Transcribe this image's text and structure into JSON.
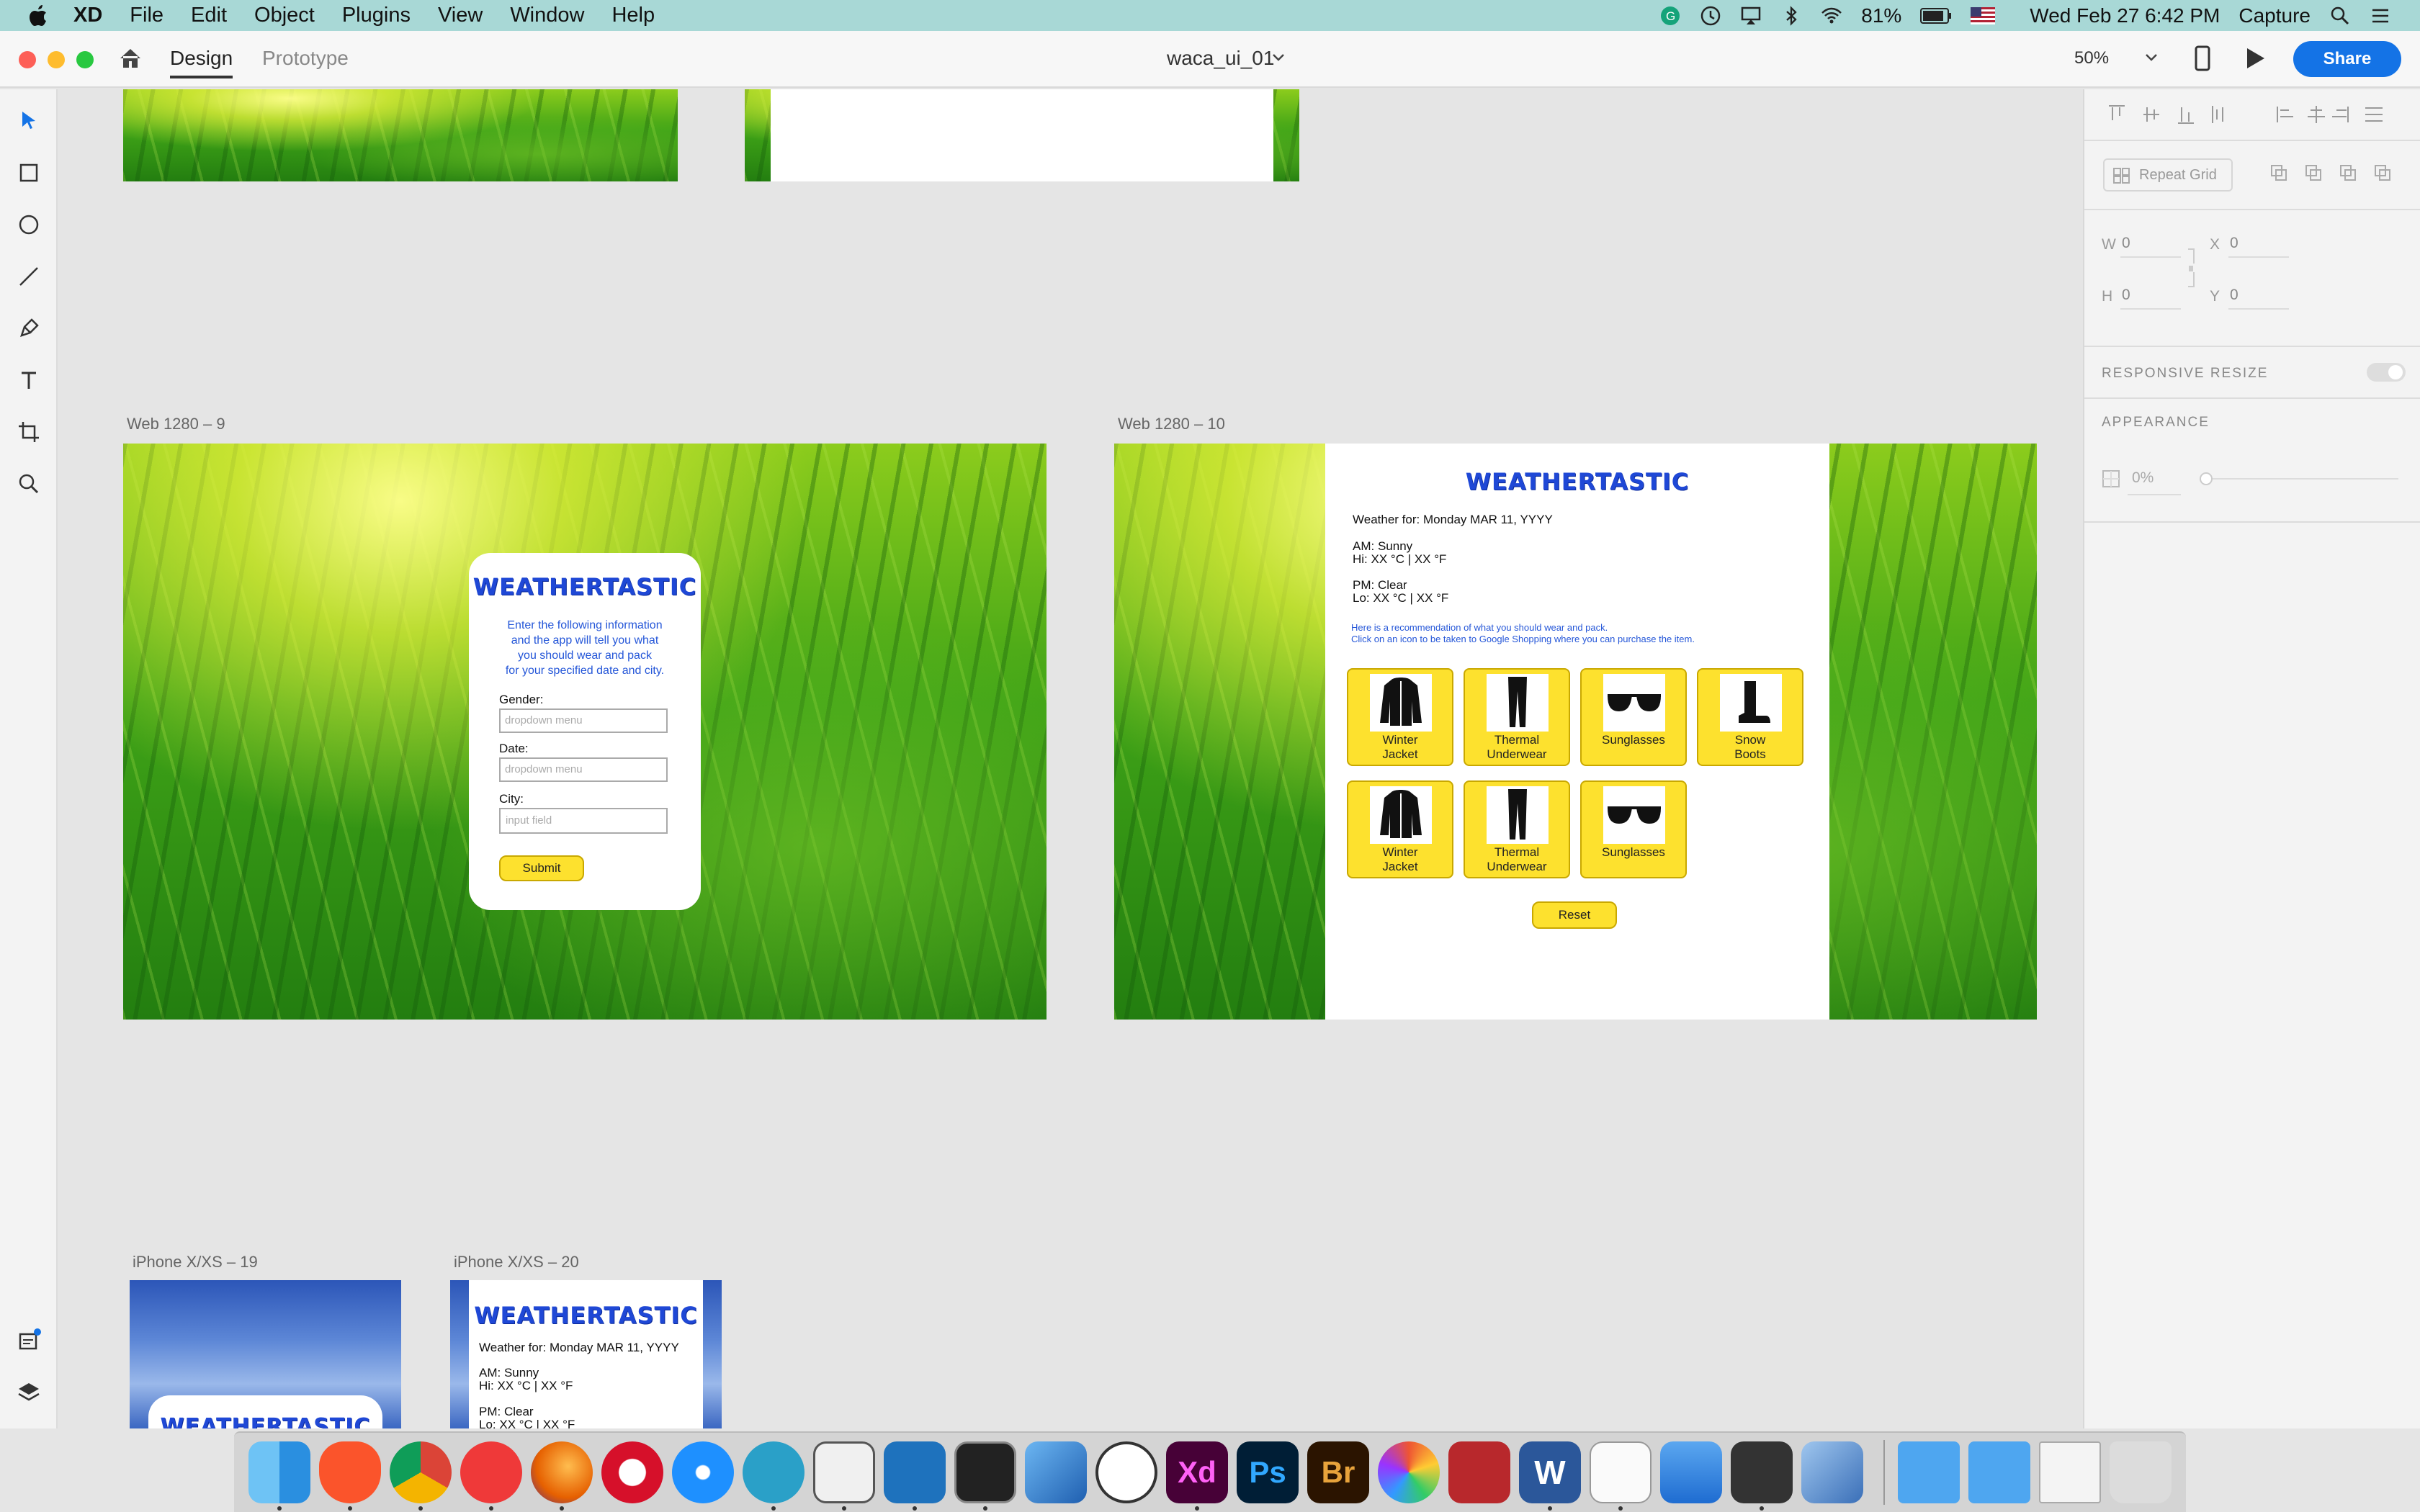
{
  "menubar": {
    "app": "XD",
    "items": [
      "File",
      "Edit",
      "Object",
      "Plugins",
      "View",
      "Window",
      "Help"
    ],
    "battery": "81%",
    "datetime": "Wed Feb 27  6:42 PM",
    "capture": "Capture"
  },
  "titlebar": {
    "tab_design": "Design",
    "tab_prototype": "Prototype",
    "document": "waca_ui_01",
    "zoom": "50%",
    "share": "Share"
  },
  "right_panel": {
    "repeat_grid": "Repeat Grid",
    "w_label": "W",
    "w_value": "0",
    "h_label": "H",
    "h_value": "0",
    "x_label": "X",
    "x_value": "0",
    "y_label": "Y",
    "y_value": "0",
    "responsive_resize": "RESPONSIVE RESIZE",
    "appearance": "APPEARANCE",
    "opacity": "0%"
  },
  "artboards": {
    "web9": {
      "label": "Web 1280 – 9",
      "logo": "WEATHERTASTIC",
      "intro": [
        "Enter the following information",
        "and the app will tell you what",
        "you should wear and pack",
        "for your specified date and city."
      ],
      "gender_label": "Gender:",
      "gender_placeholder": "dropdown menu",
      "date_label": "Date:",
      "date_placeholder": "dropdown menu",
      "city_label": "City:",
      "city_placeholder": "input field",
      "submit": "Submit"
    },
    "web10": {
      "label": "Web 1280 – 10",
      "logo": "WEATHERTASTIC",
      "weather_for": "Weather for: Monday MAR 11, YYYY",
      "am": "AM: Sunny",
      "hi": "Hi: XX °C | XX °F",
      "pm": "PM: Clear",
      "lo": "Lo: XX °C | XX °F",
      "rec1": "Here is a recommendation of what you should wear and pack.",
      "rec2": "Click on an icon to be taken to Google Shopping where you can purchase the item.",
      "items_row1": [
        {
          "l1": "Winter",
          "l2": "Jacket",
          "icon": "jacket-icon"
        },
        {
          "l1": "Thermal",
          "l2": "Underwear",
          "icon": "thermal-underwear-icon"
        },
        {
          "l1": "Sunglasses",
          "l2": "",
          "icon": "sunglasses-icon"
        },
        {
          "l1": "Snow",
          "l2": "Boots",
          "icon": "boot-icon"
        }
      ],
      "items_row2": [
        {
          "l1": "Winter",
          "l2": "Jacket",
          "icon": "jacket-icon"
        },
        {
          "l1": "Thermal",
          "l2": "Underwear",
          "icon": "thermal-underwear-icon"
        },
        {
          "l1": "Sunglasses",
          "l2": "",
          "icon": "sunglasses-icon"
        }
      ],
      "reset": "Reset"
    },
    "iphone19": {
      "label": "iPhone X/XS – 19",
      "logo": "WEATHERTASTIC"
    },
    "iphone20": {
      "label": "iPhone X/XS – 20",
      "logo": "WEATHERTASTIC",
      "weather_for": "Weather for: Monday MAR 11, YYYY",
      "am": "AM: Sunny",
      "hi": "Hi: XX °C | XX °F",
      "pm": "PM: Clear",
      "lo": "Lo: XX °C | XX °F"
    }
  },
  "dock": {
    "apps": [
      "Finder",
      "Brave",
      "Chrome",
      "Vivaldi",
      "Firefox",
      "Opera",
      "Safari",
      "MacDown",
      "Slack",
      "Visual Studio Code",
      "Terminal",
      "Xcode",
      "Clock",
      "Xd",
      "Ps",
      "Br",
      "Color",
      "Photo Booth",
      "Word",
      "TextEdit",
      "Keynote",
      "Calculator",
      "Preview",
      "Applications",
      "Downloads",
      "Window",
      "Trash"
    ],
    "labels": {
      "xd": "Xd",
      "ps": "Ps",
      "br": "Br",
      "word": "W"
    }
  },
  "colors": {
    "accent": "#1473e6",
    "brand_blue": "#1f48d6",
    "button_yellow": "#fde12e",
    "menubar": "#a8d8d6"
  }
}
